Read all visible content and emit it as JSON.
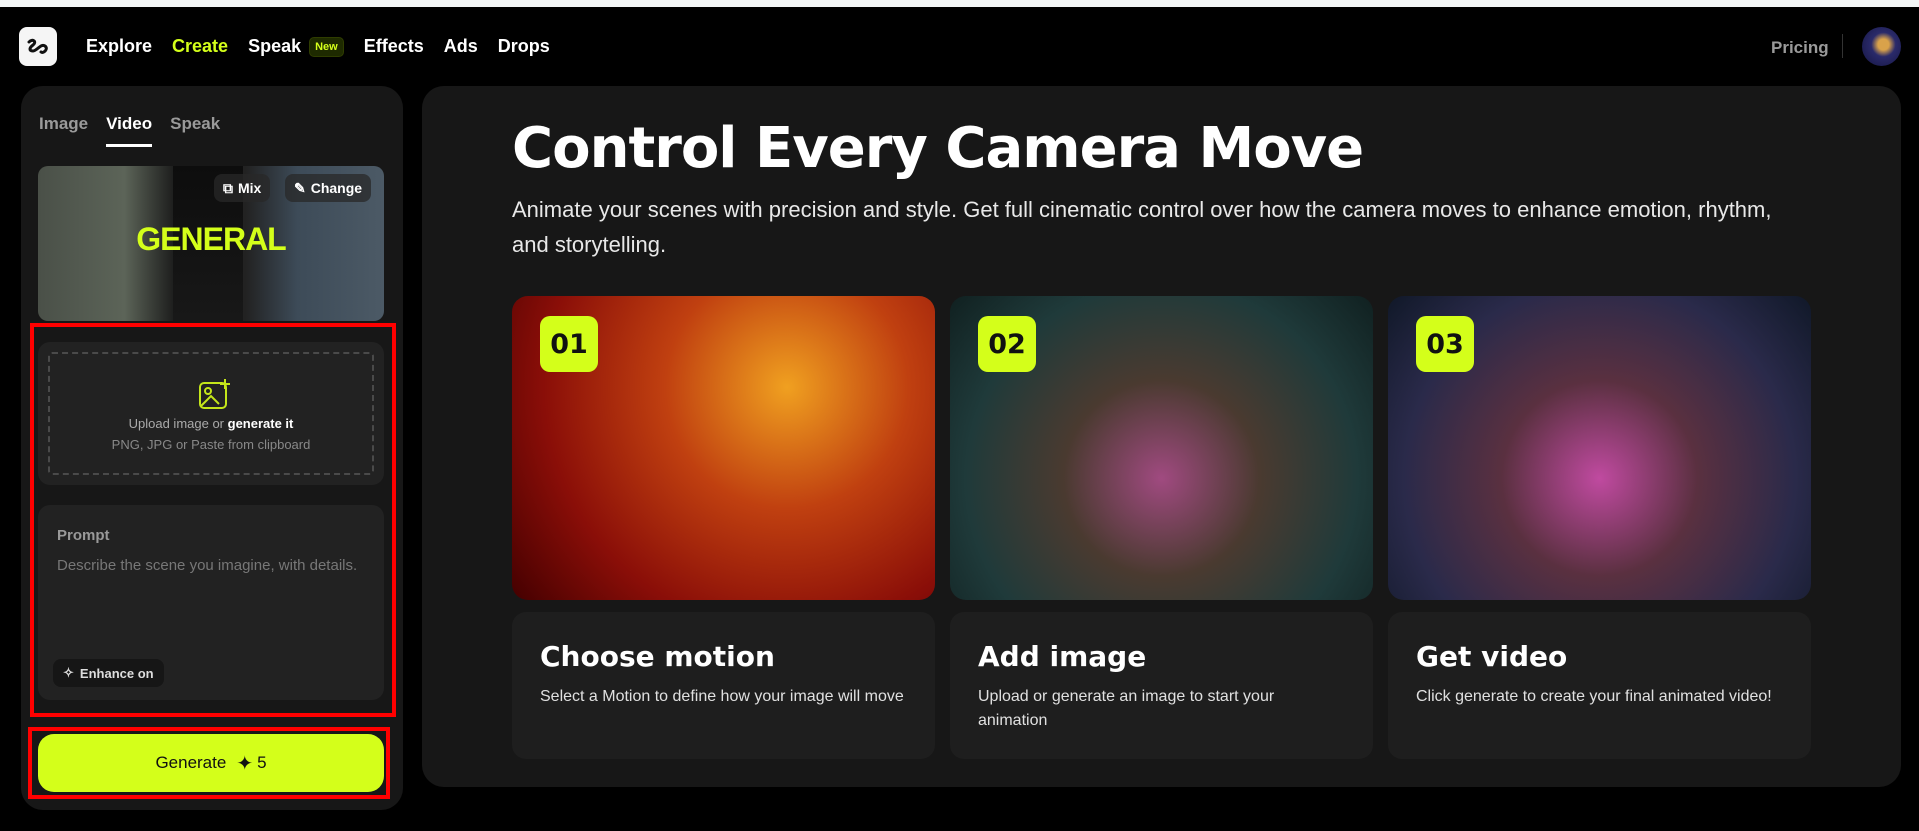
{
  "nav": {
    "items": [
      "Explore",
      "Create",
      "Speak",
      "Effects",
      "Ads",
      "Drops"
    ],
    "new_badge": "New",
    "pricing": "Pricing"
  },
  "left": {
    "tabs": [
      "Image",
      "Video",
      "Speak"
    ],
    "preview": {
      "title": "GENERAL",
      "mix": "Mix",
      "change": "Change"
    },
    "upload": {
      "line1_prefix": "Upload image or ",
      "line1_link": "generate it",
      "line2": "PNG, JPG or Paste from clipboard"
    },
    "prompt": {
      "label": "Prompt",
      "placeholder": "Describe the scene you imagine, with details.",
      "enhance": "Enhance on"
    },
    "generate": {
      "label": "Generate",
      "cost": "5"
    }
  },
  "main": {
    "title": "Control Every Camera Move",
    "subtitle": "Animate your scenes with precision and style. Get full cinematic control over how the camera moves to enhance emotion, rhythm, and storytelling.",
    "steps": [
      {
        "num": "01",
        "title": "Choose motion",
        "desc": "Select a Motion to define how your image will move"
      },
      {
        "num": "02",
        "title": "Add image",
        "desc": "Upload or generate an image to start your animation"
      },
      {
        "num": "03",
        "title": "Get video",
        "desc": "Click generate to create your final animated video!"
      }
    ]
  },
  "colors": {
    "accent": "#d4ff1a",
    "panel": "#171717",
    "highlight": "#ff0000"
  }
}
